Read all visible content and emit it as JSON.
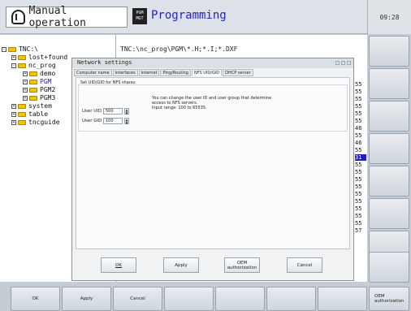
{
  "header": {
    "mode_manual": "Manual operation",
    "pgm_badge_top": "PGM",
    "pgm_badge_bottom": "MGT",
    "mode_programming": "Programming"
  },
  "clock": "09:28",
  "tree": {
    "items": [
      {
        "label": "TNC:\\"
      },
      {
        "label": "lost+found"
      },
      {
        "label": "nc_prog"
      },
      {
        "label": "demo"
      },
      {
        "label": "PGM"
      },
      {
        "label": "PGM2"
      },
      {
        "label": "PGM3"
      },
      {
        "label": "system"
      },
      {
        "label": "table"
      },
      {
        "label": "tncguide"
      }
    ]
  },
  "file_path": "TNC:\\nc_prog\\PGM\\*.H;*.I;*.DXF",
  "numbers": [
    "55",
    "55",
    "55",
    "55",
    "55",
    "55",
    "46",
    "55",
    "46",
    "55",
    "31",
    "55",
    "55",
    "55",
    "55",
    "55",
    "55",
    "55",
    "55",
    "55",
    "57"
  ],
  "dialog": {
    "title": "Network settings",
    "tabs": [
      "Computer name",
      "Interfaces",
      "Internet",
      "Ping/Routing",
      "NFS UID/GID",
      "DHCP server"
    ],
    "active_tab": "NFS UID/GID",
    "group_label": "Set UID/GID for NFS shares",
    "info_lines": [
      "You can change the user ID and user group that determine",
      "access to NFS servers.",
      "Input range: 100 to 65535."
    ],
    "user_uid_label": "User UID",
    "user_uid_value": "500",
    "user_gid_label": "User GID",
    "user_gid_value": "100",
    "spin_up": "▲",
    "spin_down": "▼",
    "buttons": {
      "ok": "OK",
      "apply": "Apply",
      "oem_line1": "OEM",
      "oem_line2": "authorization",
      "cancel": "Cancel"
    }
  },
  "softkeys_bottom": {
    "ok": "OK",
    "apply": "Apply",
    "cancel": "Cancel",
    "oem_line1": "OEM",
    "oem_line2": "authorization"
  }
}
